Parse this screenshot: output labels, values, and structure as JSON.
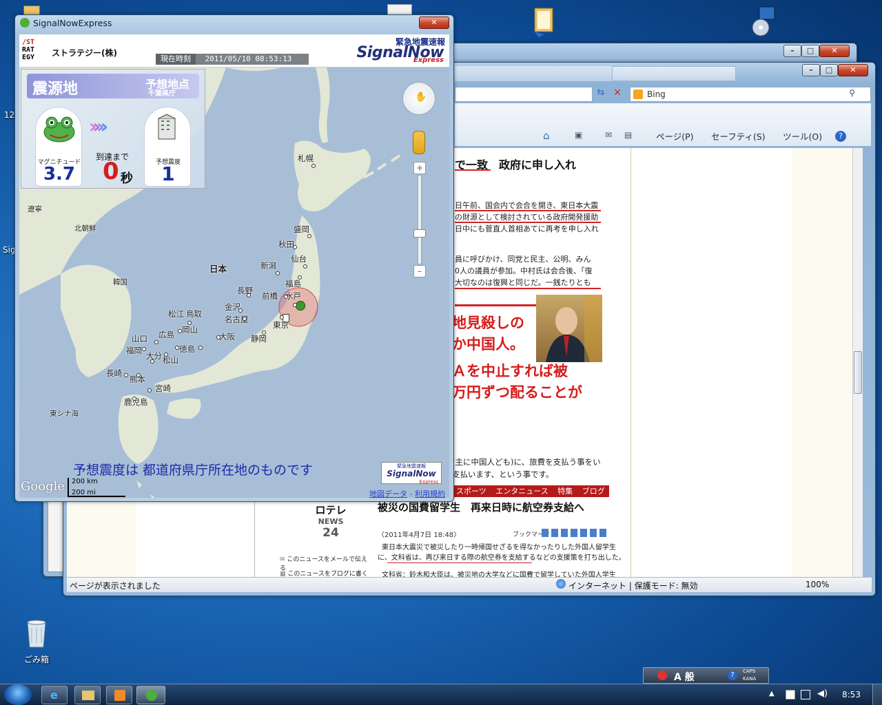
{
  "desktop": {
    "recycle_bin_label": "ごみ箱",
    "side_label_1": "12",
    "side_label_2": "Sig"
  },
  "ie": {
    "search_placeholder": "Bing",
    "cmd_page": "ページ(P)",
    "cmd_safety": "セーフティ(S)",
    "cmd_tools": "ツール(O)",
    "status_text": "ページが表示されました",
    "zone_text": "インターネット | 保護モード: 無効",
    "zoom_text": "100%",
    "frag_title": "で一致　政府に申し入れ",
    "frag_p1": [
      "日午前、国会内で会合を開き、東日本大震",
      "の財源として検討されている政府開発援助",
      "日中にも菅直人首相あてに再考を申し入れ"
    ],
    "frag_p2": [
      "員に呼びかけ、同党と民主、公明、みん",
      "0人の議員が参加。中村氏は会合後、「復",
      "大切なのは復興と同じだ。一銭たりとも"
    ],
    "frag_red": [
      "地見殺しの",
      "か中国人。",
      "Ａを中止すれば被",
      "万円ずつ配ることが"
    ],
    "frag_p3": [
      "(主に中国人ども)に、旅費を支払う事をい",
      "支払います、という事です。"
    ],
    "news_nav": [
      "スポーツ",
      "エンタニュース",
      "特集",
      "ブログ"
    ],
    "news_logo_top": "ロテレ",
    "news_logo": "NEWS",
    "news_num": "24",
    "news_headline": "被災の国費留学生　再来日時に航空券支給へ",
    "news_date": "〈2011年4月7日 18:48〉",
    "news_bookmark": "ブックマーク",
    "news_body": [
      "東日本大震災で被災したり一時帰国せざるを得なかったりした外国人留学生",
      "に、文科省は、再び来日する際の航空券を支給するなどの支援策を打ち出した。",
      "文科省：鈴木和大臣は、被災地の大学などに国費で留学していた外国人学生"
    ],
    "mail_link": "このニュースをメールで伝える",
    "blog_link": "このニュースをブログに書く"
  },
  "signalnow": {
    "window_title": "SignalNowExpress",
    "company_logo": [
      "/ST",
      "RAT",
      "EGY"
    ],
    "company_name": "ストラテジー(株)",
    "time_label": "現在時刻",
    "time_value": "2011/05/10 08:53:13",
    "alert_label": "緊急地震速報",
    "brand": "SignalNow",
    "brand_sub": "Express",
    "epicenter_label": "震源地",
    "forecast_point_label": "予想地点",
    "forecast_point_value": "千葉県庁",
    "magnitude_label": "マグニチュード",
    "magnitude_value": "3.7",
    "arrival_label": "到達まで",
    "arrival_value": "0",
    "arrival_unit": "秒",
    "intensity_label": "予想震度",
    "intensity_value": "1",
    "footer_note": "予想震度は 都道府県庁所在地のものです",
    "map_credit": "Google",
    "scale_km": "200 km",
    "scale_mi": "200 mi",
    "map_data_link": "地図データ",
    "terms_link": "利用規約",
    "mini_logo_top": "緊急地震速報",
    "mini_logo": "SignalNow",
    "mini_logo_sub": "Express",
    "cities": [
      {
        "name": "札幌"
      },
      {
        "name": "盛岡"
      },
      {
        "name": "秋田"
      },
      {
        "name": "仙台"
      },
      {
        "name": "新潟"
      },
      {
        "name": "福島"
      },
      {
        "name": "日本"
      },
      {
        "name": "長野"
      },
      {
        "name": "前橋"
      },
      {
        "name": "水戸"
      },
      {
        "name": "金沢"
      },
      {
        "name": "名古屋"
      },
      {
        "name": "東京"
      },
      {
        "name": "静岡"
      },
      {
        "name": "松江"
      },
      {
        "name": "鳥取"
      },
      {
        "name": "岡山"
      },
      {
        "name": "大阪"
      },
      {
        "name": "山口"
      },
      {
        "name": "広島"
      },
      {
        "name": "福岡"
      },
      {
        "name": "大分"
      },
      {
        "name": "徳島"
      },
      {
        "name": "松山"
      },
      {
        "name": "長崎"
      },
      {
        "name": "熊本"
      },
      {
        "name": "宮崎"
      },
      {
        "name": "鹿児島"
      },
      {
        "name": "北朝鮮"
      },
      {
        "name": "韓国"
      },
      {
        "name": "遼寧"
      },
      {
        "name": "東シナ海"
      }
    ]
  },
  "taskbar": {
    "clock": "8:53",
    "ime_mode": "A 般",
    "caps": "CAPS",
    "kana": "KANA"
  }
}
